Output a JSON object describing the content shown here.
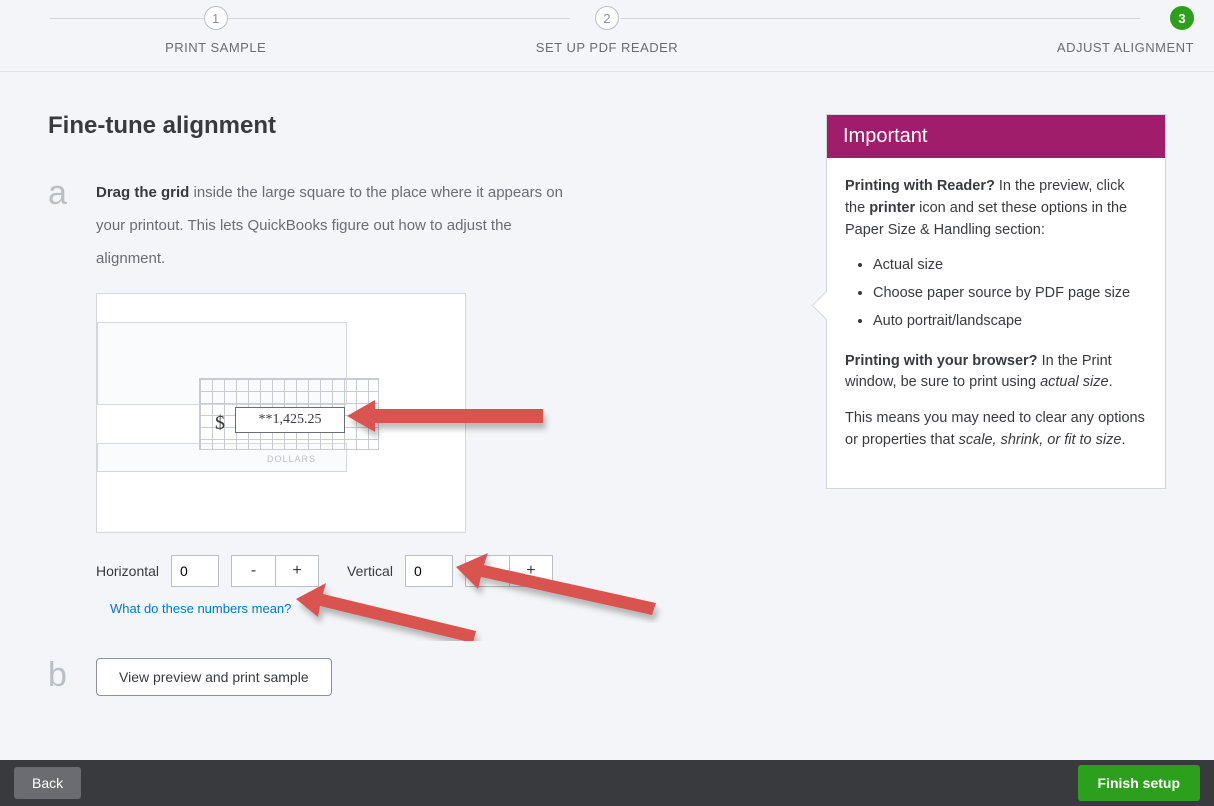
{
  "stepper": {
    "steps": [
      {
        "num": "1",
        "label": "PRINT SAMPLE"
      },
      {
        "num": "2",
        "label": "SET UP PDF READER"
      },
      {
        "num": "3",
        "label": "ADJUST ALIGNMENT"
      }
    ]
  },
  "page": {
    "title": "Fine-tune alignment",
    "section_a_letter": "a",
    "section_b_letter": "b",
    "instruction_bold": "Drag the grid",
    "instruction_rest": " inside the large square to the place where it appears on your printout. This lets QuickBooks figure out how to adjust the alignment.",
    "amount_text": "**1,425.25",
    "dollar_sign": "$",
    "dollars_label": "DOLLARS",
    "horizontal_label": "Horizontal",
    "vertical_label": "Vertical",
    "horizontal_value": "0",
    "vertical_value": "0",
    "minus": "-",
    "plus": "+",
    "help_link": "What do these numbers mean?",
    "preview_button": "View preview and print sample"
  },
  "callout": {
    "title": "Important",
    "p1_strong": "Printing with Reader?",
    "p1_rest_a": " In the preview, click the ",
    "p1_bold": "printer",
    "p1_rest_b": " icon and set these options in the Paper Size & Handling section:",
    "bullets": [
      "Actual size",
      "Choose paper source by PDF page size",
      "Auto portrait/landscape"
    ],
    "p2_strong": "Printing with your browser?",
    "p2_rest_a": " In the Print window, be sure to print using ",
    "p2_em": "actual size",
    "p2_rest_b": ".",
    "p3_a": "This means you may need to clear any options or properties that ",
    "p3_em": "scale, shrink, or fit to size",
    "p3_b": "."
  },
  "footer": {
    "back": "Back",
    "finish": "Finish setup"
  }
}
